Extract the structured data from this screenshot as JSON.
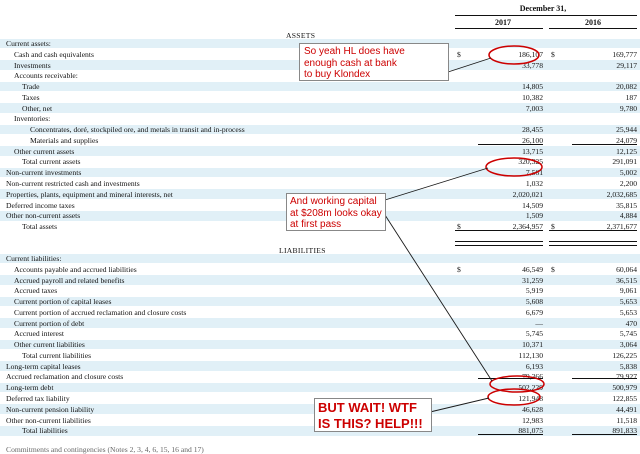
{
  "header": {
    "period": "December 31,",
    "year_current": "2017",
    "year_prior": "2016"
  },
  "sections": {
    "assets": "ASSETS",
    "liabilities": "LIABILITIES"
  },
  "rows": [
    {
      "label": "Current assets:",
      "indent": 0,
      "c1": "",
      "c2": "",
      "band": true
    },
    {
      "label": "Cash and cash equivalents",
      "indent": 1,
      "cur1": "$",
      "c1": "186,107",
      "cur2": "$",
      "c2": "169,777",
      "band": false
    },
    {
      "label": "Investments",
      "indent": 1,
      "c1": "33,778",
      "c2": "29,117",
      "band": true
    },
    {
      "label": "Accounts receivable:",
      "indent": 1,
      "c1": "",
      "c2": "",
      "band": false
    },
    {
      "label": "Trade",
      "indent": 2,
      "c1": "14,805",
      "c2": "20,082",
      "band": true
    },
    {
      "label": "Taxes",
      "indent": 2,
      "c1": "10,382",
      "c2": "187",
      "band": false
    },
    {
      "label": "Other, net",
      "indent": 2,
      "c1": "7,003",
      "c2": "9,780",
      "band": true
    },
    {
      "label": "Inventories:",
      "indent": 1,
      "c1": "",
      "c2": "",
      "band": false
    },
    {
      "label": "Concentrates, doré, stockpiled ore, and metals in transit and in-process",
      "indent": 3,
      "c1": "28,455",
      "c2": "25,944",
      "band": true
    },
    {
      "label": "Materials and supplies",
      "indent": 3,
      "c1": "26,100",
      "c2": "24,079",
      "band": false
    },
    {
      "label": "Other current assets",
      "indent": 1,
      "c1": "13,715",
      "c2": "12,125",
      "band": true
    },
    {
      "label": "Total current assets",
      "indent": 2,
      "c1": "320,325",
      "c2": "291,091",
      "band": false
    },
    {
      "label": "Non-current investments",
      "indent": 0,
      "c1": "7,561",
      "c2": "5,002",
      "band": true
    },
    {
      "label": "Non-current restricted cash and investments",
      "indent": 0,
      "c1": "1,032",
      "c2": "2,200",
      "band": false
    },
    {
      "label": "Properties, plants, equipment and mineral interests, net",
      "indent": 0,
      "c1": "2,020,021",
      "c2": "2,032,685",
      "band": true
    },
    {
      "label": "Deferred income taxes",
      "indent": 0,
      "c1": "14,509",
      "c2": "35,815",
      "band": false
    },
    {
      "label": "Other non-current assets",
      "indent": 0,
      "c1": "1,509",
      "c2": "4,884",
      "band": true
    },
    {
      "label": "Total assets",
      "indent": 2,
      "cur1": "$",
      "c1": "2,364,957",
      "cur2": "$",
      "c2": "2,371,677",
      "band": false
    },
    {
      "label": "Current liabilities:",
      "indent": 0,
      "c1": "",
      "c2": "",
      "band": true
    },
    {
      "label": "Accounts payable and accrued liabilities",
      "indent": 1,
      "cur1": "$",
      "c1": "46,549",
      "cur2": "$",
      "c2": "60,064",
      "band": false
    },
    {
      "label": "Accrued payroll and related benefits",
      "indent": 1,
      "c1": "31,259",
      "c2": "36,515",
      "band": true
    },
    {
      "label": "Accrued taxes",
      "indent": 1,
      "c1": "5,919",
      "c2": "9,061",
      "band": false
    },
    {
      "label": "Current portion of capital leases",
      "indent": 1,
      "c1": "5,608",
      "c2": "5,653",
      "band": true
    },
    {
      "label": "Current portion of accrued reclamation and closure costs",
      "indent": 1,
      "c1": "6,679",
      "c2": "5,653",
      "band": false
    },
    {
      "label": "Current portion of debt",
      "indent": 1,
      "c1": "—",
      "c2": "470",
      "band": true
    },
    {
      "label": "Accrued interest",
      "indent": 1,
      "c1": "5,745",
      "c2": "5,745",
      "band": false
    },
    {
      "label": "Other current liabilities",
      "indent": 1,
      "c1": "10,371",
      "c2": "3,064",
      "band": true
    },
    {
      "label": "Total current liabilities",
      "indent": 2,
      "c1": "112,130",
      "c2": "126,225",
      "band": false
    },
    {
      "label": "Long-term capital leases",
      "indent": 0,
      "c1": "6,193",
      "c2": "5,838",
      "band": true
    },
    {
      "label": "Accrued reclamation and closure costs",
      "indent": 0,
      "c1": "79,366",
      "c2": "79,927",
      "band": false
    },
    {
      "label": "Long-term debt",
      "indent": 0,
      "c1": "502,229",
      "c2": "500,979",
      "band": true
    },
    {
      "label": "Deferred tax liability",
      "indent": 0,
      "c1": "121,948",
      "c2": "122,855",
      "band": false
    },
    {
      "label": "Non-current pension liability",
      "indent": 0,
      "c1": "46,628",
      "c2": "44,491",
      "band": true
    },
    {
      "label": "Other non-current liabilities",
      "indent": 0,
      "c1": "12,983",
      "c2": "11,518",
      "band": false
    },
    {
      "label": "Total liabilities",
      "indent": 2,
      "c1": "881,075",
      "c2": "891,833",
      "band": true
    }
  ],
  "cutoff_text": "Commitments and contingencies (Notes 2, 3, 4, 6, 15, 16 and 17)",
  "annotations": {
    "note1": [
      "So yeah HL does have",
      "enough cash at bank",
      "to buy Klondex"
    ],
    "note2": [
      "And working capital",
      "at $208m looks okay",
      "at first pass"
    ],
    "note3": [
      "BUT WAIT! WTF",
      "IS THIS? HELP!!!"
    ]
  },
  "colors": {
    "band": "#e1f0f7",
    "annotation_red": "#cc0000",
    "annotation_arrow": "#1a1a1a"
  }
}
